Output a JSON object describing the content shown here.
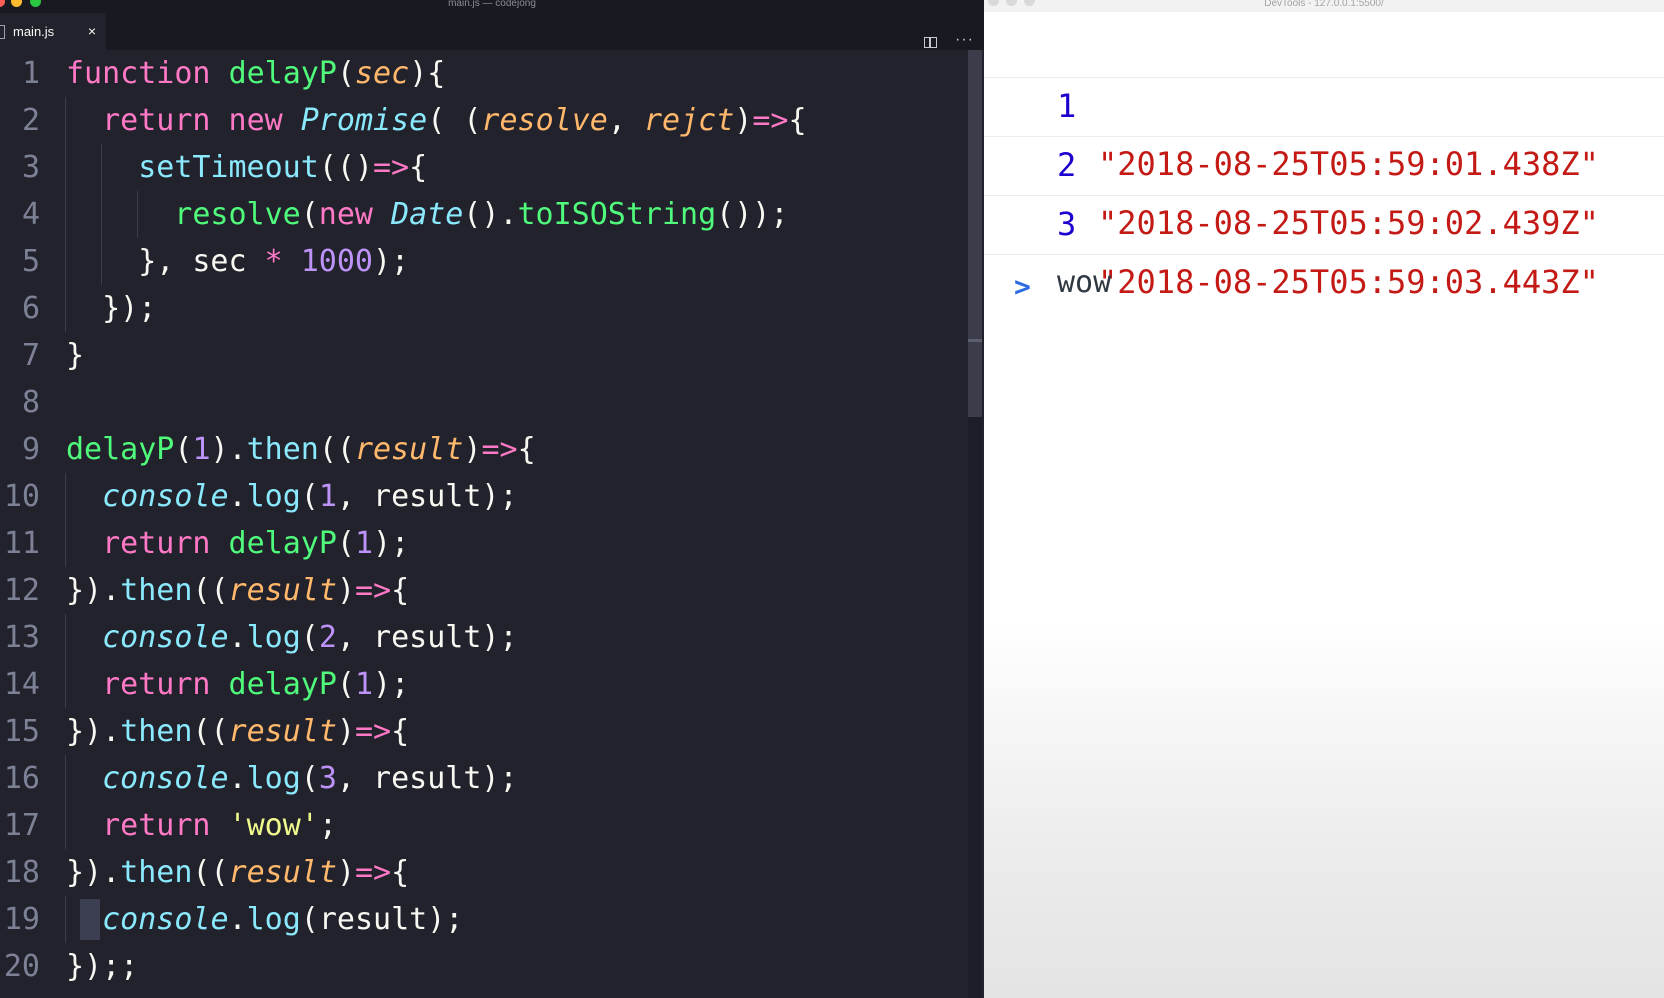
{
  "editor": {
    "window_title": "main.js — codejong",
    "tab": {
      "label": "main.js",
      "close_glyph": "×"
    },
    "more_glyph": "···",
    "lines": [
      {
        "n": "1",
        "indent": 0,
        "t": [
          [
            "k",
            "function"
          ],
          [
            "x",
            " "
          ],
          [
            "f",
            "delayP"
          ],
          [
            "x",
            "("
          ],
          [
            "p",
            "sec"
          ],
          [
            "x",
            "){"
          ]
        ]
      },
      {
        "n": "2",
        "indent": 1,
        "t": [
          [
            "k",
            "return"
          ],
          [
            "x",
            " "
          ],
          [
            "k",
            "new"
          ],
          [
            "x",
            " "
          ],
          [
            "c",
            "Promise"
          ],
          [
            "x",
            "( ("
          ],
          [
            "p",
            "resolve"
          ],
          [
            "x",
            ", "
          ],
          [
            "p",
            "rejct"
          ],
          [
            "x",
            ")"
          ],
          [
            "o",
            "=>"
          ],
          [
            "x",
            "{"
          ]
        ]
      },
      {
        "n": "3",
        "indent": 2,
        "t": [
          [
            "m",
            "setTimeout"
          ],
          [
            "x",
            "(()"
          ],
          [
            "o",
            "=>"
          ],
          [
            "x",
            "{"
          ]
        ]
      },
      {
        "n": "4",
        "indent": 3,
        "t": [
          [
            "f",
            "resolve"
          ],
          [
            "x",
            "("
          ],
          [
            "k",
            "new"
          ],
          [
            "x",
            " "
          ],
          [
            "c",
            "Date"
          ],
          [
            "x",
            "()."
          ],
          [
            "f",
            "toISOString"
          ],
          [
            "x",
            "());"
          ]
        ]
      },
      {
        "n": "5",
        "indent": 2,
        "t": [
          [
            "x",
            "}, sec "
          ],
          [
            "o",
            "*"
          ],
          [
            "x",
            " "
          ],
          [
            "n",
            "1000"
          ],
          [
            "x",
            ");"
          ]
        ]
      },
      {
        "n": "6",
        "indent": 1,
        "t": [
          [
            "x",
            "});"
          ]
        ]
      },
      {
        "n": "7",
        "indent": 0,
        "t": [
          [
            "x",
            "}"
          ]
        ]
      },
      {
        "n": "8",
        "indent": 0,
        "t": []
      },
      {
        "n": "9",
        "indent": 0,
        "t": [
          [
            "f",
            "delayP"
          ],
          [
            "x",
            "("
          ],
          [
            "n",
            "1"
          ],
          [
            "x",
            ")."
          ],
          [
            "m",
            "then"
          ],
          [
            "x",
            "(("
          ],
          [
            "p",
            "result"
          ],
          [
            "x",
            ")"
          ],
          [
            "o",
            "=>"
          ],
          [
            "x",
            "{"
          ]
        ]
      },
      {
        "n": "10",
        "indent": 1,
        "t": [
          [
            "c",
            "console"
          ],
          [
            "x",
            "."
          ],
          [
            "m",
            "log"
          ],
          [
            "x",
            "("
          ],
          [
            "n",
            "1"
          ],
          [
            "x",
            ", result);"
          ]
        ]
      },
      {
        "n": "11",
        "indent": 1,
        "t": [
          [
            "k",
            "return"
          ],
          [
            "x",
            " "
          ],
          [
            "f",
            "delayP"
          ],
          [
            "x",
            "("
          ],
          [
            "n",
            "1"
          ],
          [
            "x",
            ");"
          ]
        ]
      },
      {
        "n": "12",
        "indent": 0,
        "t": [
          [
            "x",
            "})."
          ],
          [
            "m",
            "then"
          ],
          [
            "x",
            "(("
          ],
          [
            "p",
            "result"
          ],
          [
            "x",
            ")"
          ],
          [
            "o",
            "=>"
          ],
          [
            "x",
            "{"
          ]
        ]
      },
      {
        "n": "13",
        "indent": 1,
        "t": [
          [
            "c",
            "console"
          ],
          [
            "x",
            "."
          ],
          [
            "m",
            "log"
          ],
          [
            "x",
            "("
          ],
          [
            "n",
            "2"
          ],
          [
            "x",
            ", result);"
          ]
        ]
      },
      {
        "n": "14",
        "indent": 1,
        "t": [
          [
            "k",
            "return"
          ],
          [
            "x",
            " "
          ],
          [
            "f",
            "delayP"
          ],
          [
            "x",
            "("
          ],
          [
            "n",
            "1"
          ],
          [
            "x",
            ");"
          ]
        ]
      },
      {
        "n": "15",
        "indent": 0,
        "t": [
          [
            "x",
            "})."
          ],
          [
            "m",
            "then"
          ],
          [
            "x",
            "(("
          ],
          [
            "p",
            "result"
          ],
          [
            "x",
            ")"
          ],
          [
            "o",
            "=>"
          ],
          [
            "x",
            "{"
          ]
        ]
      },
      {
        "n": "16",
        "indent": 1,
        "t": [
          [
            "c",
            "console"
          ],
          [
            "x",
            "."
          ],
          [
            "m",
            "log"
          ],
          [
            "x",
            "("
          ],
          [
            "n",
            "3"
          ],
          [
            "x",
            ", result);"
          ]
        ]
      },
      {
        "n": "17",
        "indent": 1,
        "t": [
          [
            "k",
            "return"
          ],
          [
            "x",
            " "
          ],
          [
            "s",
            "'wow'"
          ],
          [
            "x",
            ";"
          ]
        ]
      },
      {
        "n": "18",
        "indent": 0,
        "t": [
          [
            "x",
            "})."
          ],
          [
            "m",
            "then"
          ],
          [
            "x",
            "(("
          ],
          [
            "p",
            "result"
          ],
          [
            "x",
            ")"
          ],
          [
            "o",
            "=>"
          ],
          [
            "x",
            "{"
          ]
        ]
      },
      {
        "n": "19",
        "indent": 1,
        "cursor": true,
        "t": [
          [
            "c",
            "console"
          ],
          [
            "x",
            "."
          ],
          [
            "m",
            "log"
          ],
          [
            "x",
            "(result);"
          ]
        ]
      },
      {
        "n": "20",
        "indent": 0,
        "t": [
          [
            "x",
            "});;"
          ]
        ]
      }
    ]
  },
  "devtools": {
    "window_title": "DevTools - 127.0.0.1:5500/",
    "messages": [
      {
        "num": "1",
        "value": "\"2018-08-25T05:59:01.438Z\""
      },
      {
        "num": "2",
        "value": "\"2018-08-25T05:59:02.439Z\""
      },
      {
        "num": "3",
        "value": "\"2018-08-25T05:59:03.443Z\""
      }
    ],
    "plain_message": "wow",
    "prompt_glyph": ">"
  },
  "colors": {
    "keyword": "#ff79c6",
    "function": "#50fa7b",
    "class": "#8be9fd",
    "param": "#ffb86c",
    "number": "#bd93f9",
    "string": "#f1fa8c",
    "console_number": "#1c00cf",
    "console_string": "#c41a16",
    "prompt": "#2d6be4"
  }
}
